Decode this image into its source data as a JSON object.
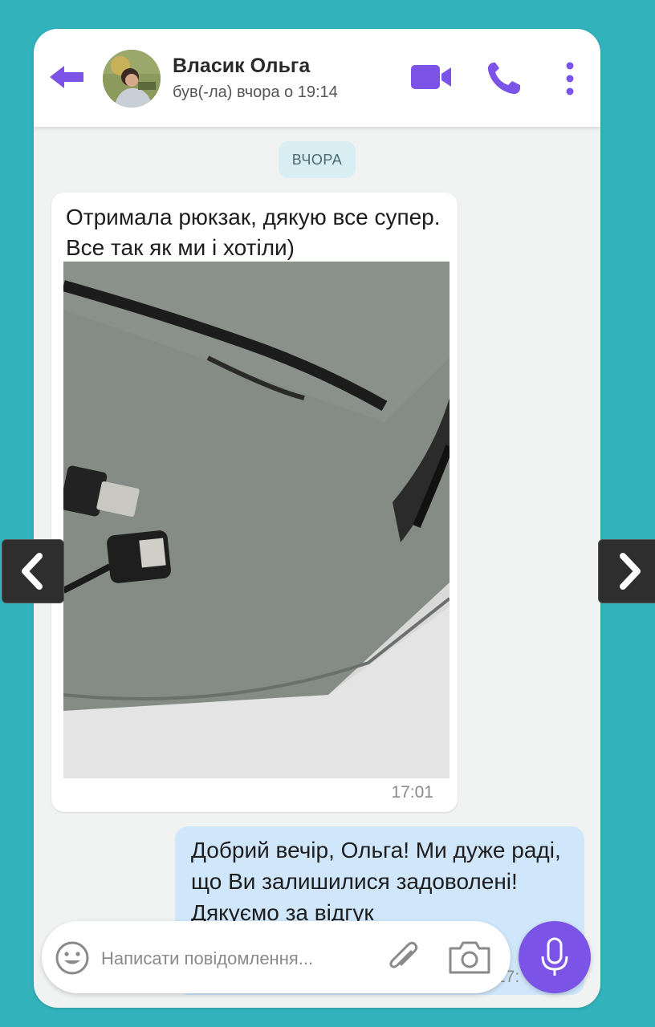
{
  "header": {
    "contact_name": "Власик Ольга",
    "status": "був(-ла) вчора о 19:14",
    "accent_color": "#7b53e6"
  },
  "chat": {
    "date_chip": "ВЧОРА",
    "incoming": {
      "text": "Отримала рюкзак, дякую все супер. Все так як ми і хотіли)",
      "time": "17:01",
      "image": "photo of grey backpack with USB port"
    },
    "outgoing": {
      "text": "Добрий вечір, Ольга! Ми дуже раді, що Ви залишилися задоволені! Дякуємо за відгук",
      "time": "17:"
    }
  },
  "composer": {
    "placeholder": "Написати повідомлення..."
  },
  "icons": [
    "back-arrow-icon",
    "video-camera-icon",
    "phone-icon",
    "more-vertical-icon",
    "emoji-icon",
    "paperclip-icon",
    "camera-icon",
    "microphone-icon",
    "chevron-left-icon",
    "chevron-right-icon"
  ]
}
